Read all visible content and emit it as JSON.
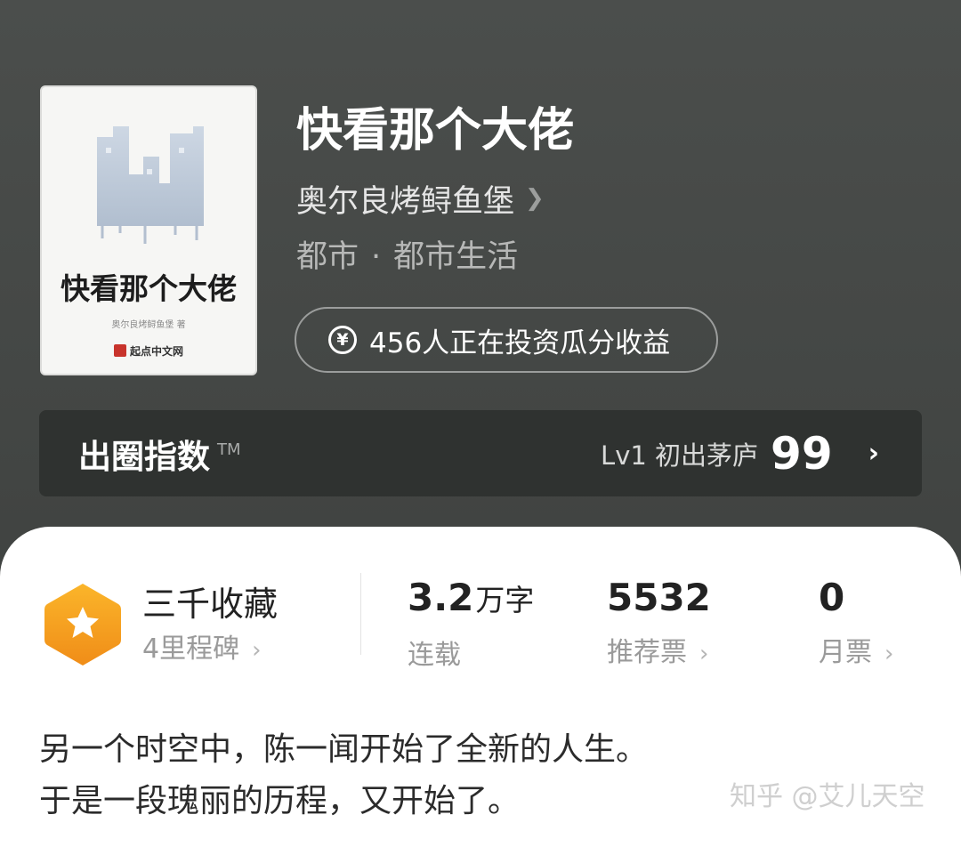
{
  "book": {
    "title": "快看那个大佬",
    "author": "奥尔良烤鲟鱼堡",
    "genre_main": "都市",
    "genre_separator": "·",
    "genre_sub": "都市生活"
  },
  "cover": {
    "title": "快看那个大佬",
    "author_line": "奥尔良烤鲟鱼堡 著",
    "publisher": "起点中文网"
  },
  "invest": {
    "icon": "yen-circle-icon",
    "icon_glyph": "¥",
    "text": "456人正在投资瓜分收益"
  },
  "index": {
    "label": "出圈指数",
    "tm": "TM",
    "level": "Lv1 初出茅庐",
    "score": "99",
    "chevron": "›"
  },
  "stats": {
    "favorites": {
      "title": "三千收藏",
      "sub": "4里程碑"
    },
    "words": {
      "value": "3.2",
      "unit": "万字",
      "label": "连载"
    },
    "recommend": {
      "value": "5532",
      "label": "推荐票"
    },
    "monthly": {
      "value": "0",
      "label": "月票"
    },
    "chevron": "›"
  },
  "synopsis": {
    "line1": "另一个时空中，陈一闻开始了全新的人生。",
    "line2": "于是一段瑰丽的历程，又开始了。"
  },
  "watermark": "知乎 @艾儿天空",
  "colors": {
    "header_bg": "#474a48",
    "badge_orange": "#f6a21e",
    "card_bg": "#ffffff"
  }
}
